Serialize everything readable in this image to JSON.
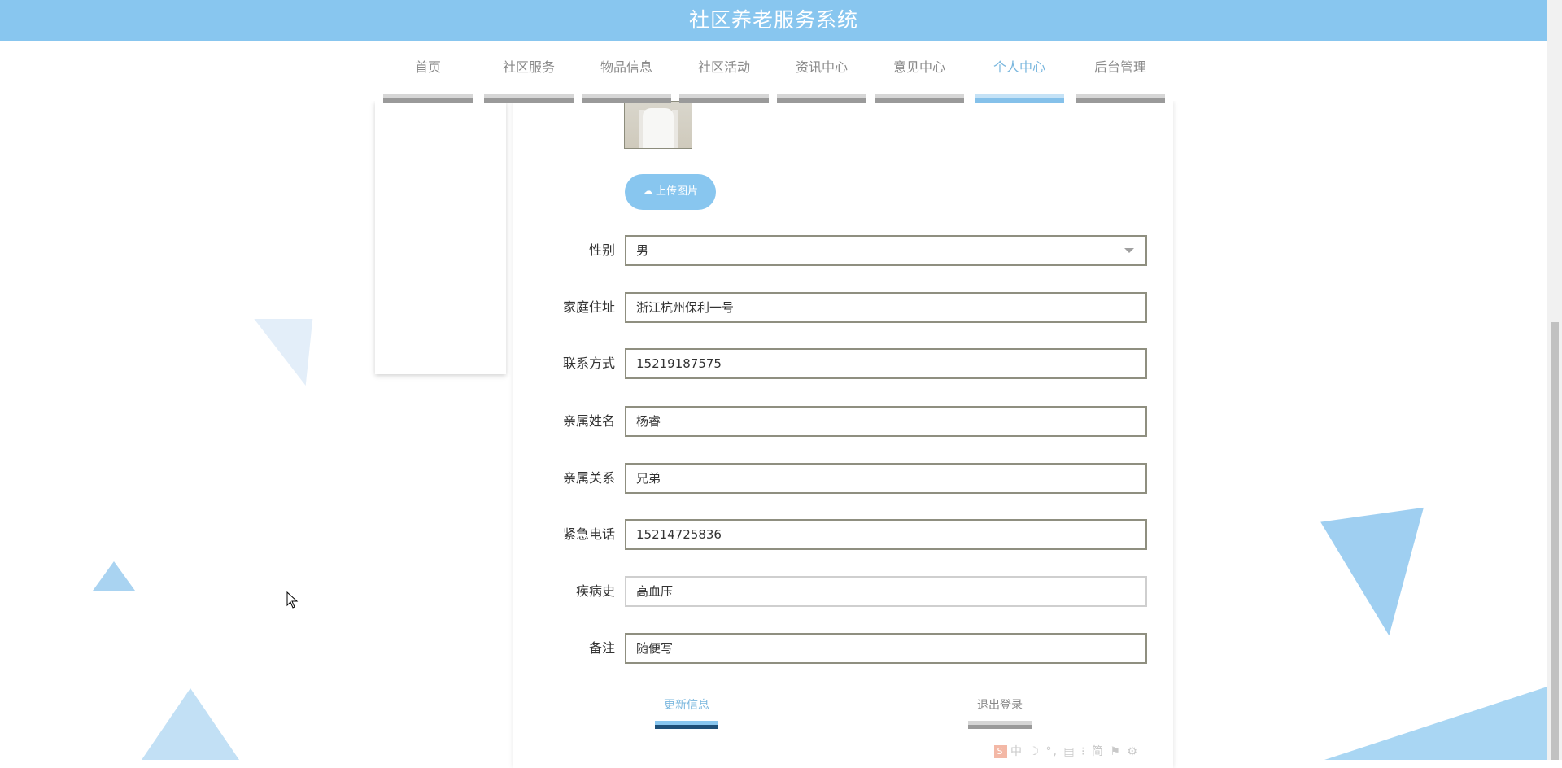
{
  "header": {
    "title": "社区养老服务系统"
  },
  "nav": {
    "items": [
      {
        "label": "首页"
      },
      {
        "label": "社区服务"
      },
      {
        "label": "物品信息"
      },
      {
        "label": "社区活动"
      },
      {
        "label": "资讯中心"
      },
      {
        "label": "意见中心"
      },
      {
        "label": "个人中心"
      },
      {
        "label": "后台管理"
      }
    ],
    "active_label": "个人中心"
  },
  "profile": {
    "upload_label": "上传图片",
    "fields": [
      {
        "label": "性别",
        "value": "男",
        "type": "select"
      },
      {
        "label": "家庭住址",
        "value": "浙江杭州保利一号"
      },
      {
        "label": "联系方式",
        "value": "15219187575"
      },
      {
        "label": "亲属姓名",
        "value": "杨睿"
      },
      {
        "label": "亲属关系",
        "value": "兄弟"
      },
      {
        "label": "紧急电话",
        "value": "15214725836"
      },
      {
        "label": "疾病史",
        "value": "高血压",
        "focused": true
      },
      {
        "label": "备注",
        "value": "随便写"
      }
    ],
    "update_label": "更新信息",
    "logout_label": "退出登录"
  },
  "ime_toolbar": {
    "text": "中 ☽ °, ▤ ⁝ 简 ⚑ ⚙"
  },
  "colors": {
    "accent": "#88c6ef",
    "accent_dark": "#1e4f78",
    "field_border": "#8f8f80",
    "triangle_light": "#e3eef9",
    "triangle_mid": "#9fcff1"
  },
  "icons": [
    "cloud-upload-icon",
    "dropdown-arrow-icon",
    "mouse-cursor-icon",
    "ime-logo-icon"
  ]
}
